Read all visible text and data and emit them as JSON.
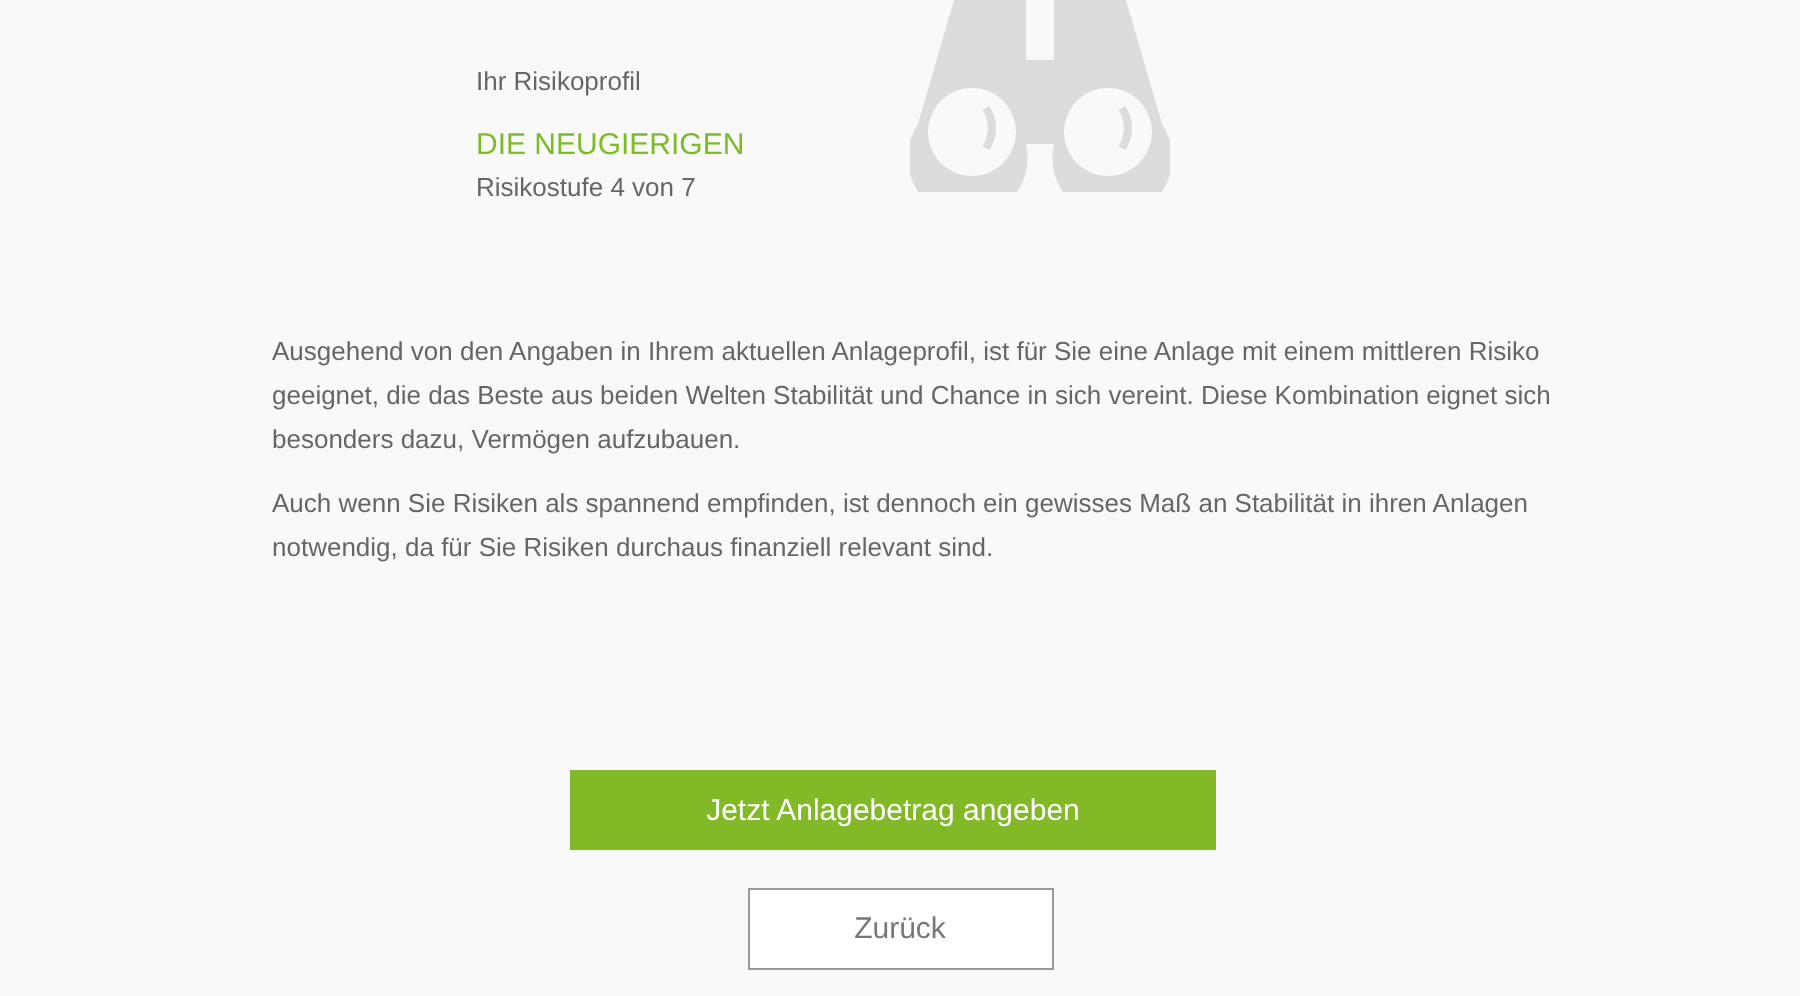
{
  "profile": {
    "caption": "Ihr Risikoprofil",
    "name": "DIE NEUGIERIGEN",
    "level_text": "Risikostufe 4 von 7"
  },
  "paragraphs": [
    "Ausgehend von den Angaben in Ihrem aktuellen Anlageprofil, ist für Sie eine Anlage mit einem mittleren Risiko geeignet, die das Beste aus beiden Welten Stabilität und Chance in sich vereint. Diese Kombination eignet sich besonders dazu, Vermögen aufzubauen.",
    "Auch wenn Sie Risiken als spannend empfinden, ist dennoch ein gewisses Maß an Stabilität in ihren Anlagen notwendig, da für Sie Risiken durchaus finanziell relevant sind."
  ],
  "buttons": [
    {
      "label": "Jetzt Anlagebetrag angeben",
      "kind": "primary"
    },
    {
      "label": "Zurück",
      "kind": "secondary"
    }
  ]
}
